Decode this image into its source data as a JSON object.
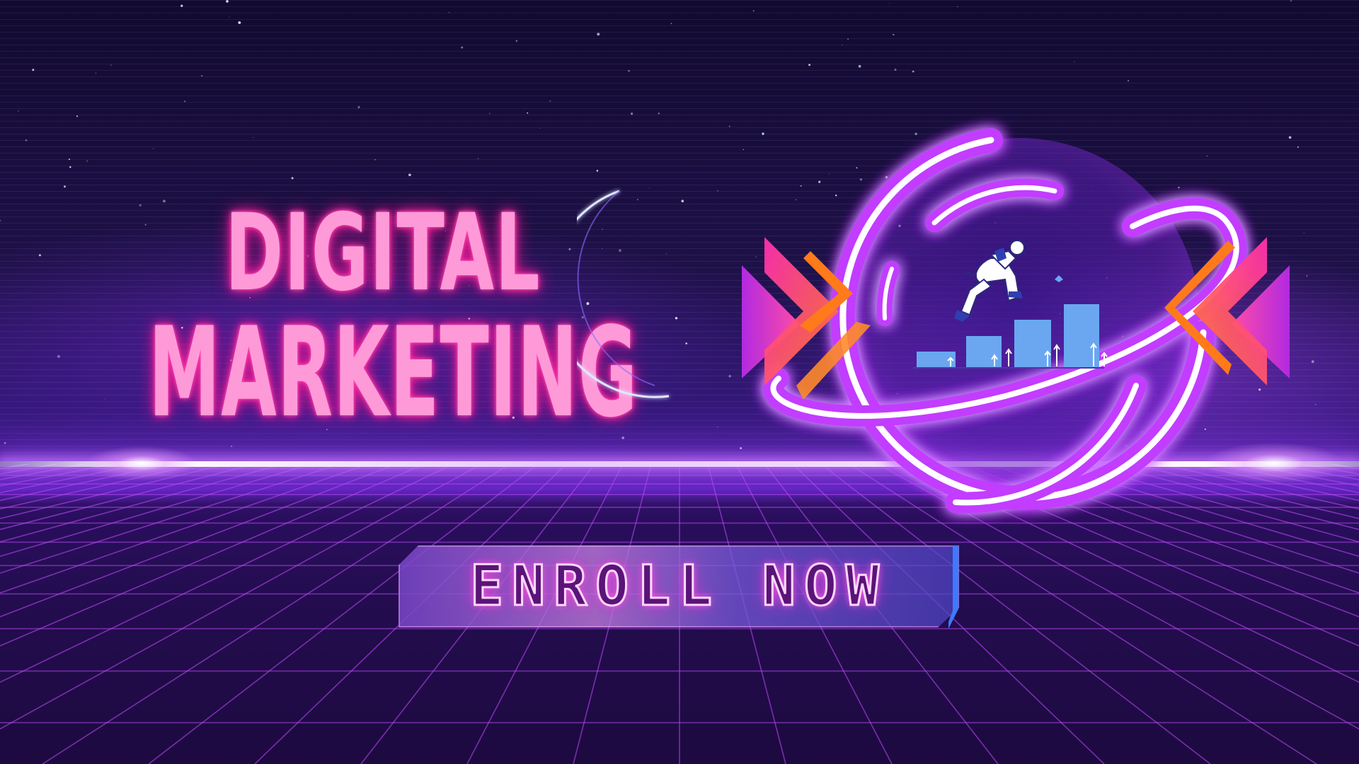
{
  "title": {
    "line1": "DIGITAL",
    "line2": "MARKETING"
  },
  "cta": {
    "label": "ENROLL NOW"
  },
  "colors": {
    "title_pink": "#ff9ad8",
    "neon_purple": "#c23dff",
    "neon_white": "#ffffff",
    "chart_blue": "#6aa7f0",
    "chevron_orange": "#ff7a1a",
    "chevron_pink": "#ff3fb0",
    "background_dark": "#1a0b3a"
  },
  "icons": {
    "planet": "neon-planet-icon",
    "runner": "jumping-person-icon",
    "bars": "growth-bar-chart-icon",
    "chevrons_left": "right-pointing-chevrons-icon",
    "chevrons_right": "left-pointing-chevrons-icon"
  }
}
